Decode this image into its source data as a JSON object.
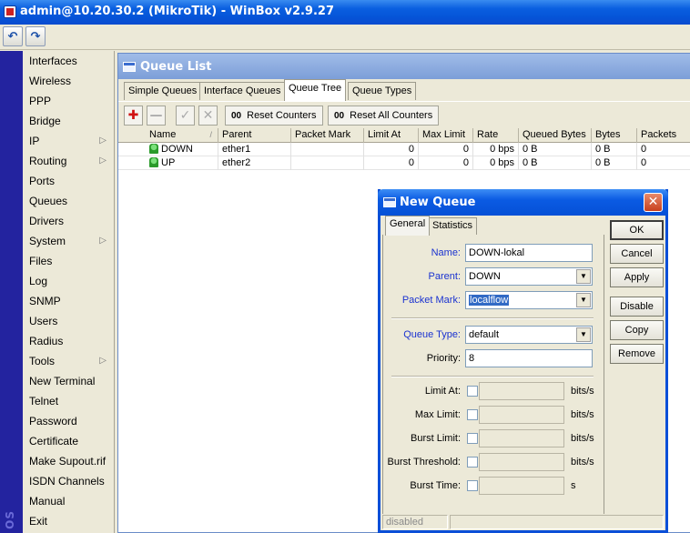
{
  "window": {
    "title": "admin@10.20.30.2 (MikroTik) - WinBox v2.9.27"
  },
  "toolbar": {
    "undo_icon": "undo-icon",
    "redo_icon": "redo-icon"
  },
  "sidebar": {
    "brand": "OS",
    "items": [
      {
        "label": "Interfaces",
        "submenu": false
      },
      {
        "label": "Wireless",
        "submenu": false
      },
      {
        "label": "PPP",
        "submenu": false
      },
      {
        "label": "Bridge",
        "submenu": false
      },
      {
        "label": "IP",
        "submenu": true
      },
      {
        "label": "Routing",
        "submenu": true
      },
      {
        "label": "Ports",
        "submenu": false
      },
      {
        "label": "Queues",
        "submenu": false
      },
      {
        "label": "Drivers",
        "submenu": false
      },
      {
        "label": "System",
        "submenu": true
      },
      {
        "label": "Files",
        "submenu": false
      },
      {
        "label": "Log",
        "submenu": false
      },
      {
        "label": "SNMP",
        "submenu": false
      },
      {
        "label": "Users",
        "submenu": false
      },
      {
        "label": "Radius",
        "submenu": false
      },
      {
        "label": "Tools",
        "submenu": true
      },
      {
        "label": "New Terminal",
        "submenu": false
      },
      {
        "label": "Telnet",
        "submenu": false
      },
      {
        "label": "Password",
        "submenu": false
      },
      {
        "label": "Certificate",
        "submenu": false
      },
      {
        "label": "Make Supout.rif",
        "submenu": false
      },
      {
        "label": "ISDN Channels",
        "submenu": false
      },
      {
        "label": "Manual",
        "submenu": false
      },
      {
        "label": "Exit",
        "submenu": false
      }
    ]
  },
  "queue_list": {
    "title": "Queue List",
    "tabs": [
      "Simple Queues",
      "Interface Queues",
      "Queue Tree",
      "Queue Types"
    ],
    "active_tab": "Queue Tree",
    "reset_counters": "Reset Counters",
    "reset_all_counters": "Reset All Counters",
    "button_prefix": "00",
    "columns": [
      "Name",
      "Parent",
      "Packet Mark",
      "Limit At",
      "Max Limit",
      "Rate",
      "Queued Bytes",
      "Bytes",
      "Packets"
    ],
    "rows": [
      {
        "name": "DOWN",
        "parent": "ether1",
        "packet_mark": "",
        "limit_at": "0",
        "max_limit": "0",
        "rate": "0 bps",
        "queued_bytes": "0 B",
        "bytes": "0 B",
        "packets": "0"
      },
      {
        "name": "UP",
        "parent": "ether2",
        "packet_mark": "",
        "limit_at": "0",
        "max_limit": "0",
        "rate": "0 bps",
        "queued_bytes": "0 B",
        "bytes": "0 B",
        "packets": "0"
      }
    ]
  },
  "dialog": {
    "title": "New Queue",
    "tabs": [
      "General",
      "Statistics"
    ],
    "fields": {
      "name": {
        "label": "Name:",
        "value": "DOWN-lokal"
      },
      "parent": {
        "label": "Parent:",
        "value": "DOWN"
      },
      "packet_mark": {
        "label": "Packet Mark:",
        "value": "localflow"
      },
      "queue_type": {
        "label": "Queue Type:",
        "value": "default"
      },
      "priority": {
        "label": "Priority:",
        "value": "8"
      },
      "limit_at": {
        "label": "Limit At:",
        "unit": "bits/s"
      },
      "max_limit": {
        "label": "Max Limit:",
        "unit": "bits/s"
      },
      "burst_limit": {
        "label": "Burst Limit:",
        "unit": "bits/s"
      },
      "burst_threshold": {
        "label": "Burst Threshold:",
        "unit": "bits/s"
      },
      "burst_time": {
        "label": "Burst Time:",
        "unit": "s"
      }
    },
    "buttons": [
      "OK",
      "Cancel",
      "Apply",
      "Disable",
      "Copy",
      "Remove"
    ],
    "status": "disabled"
  }
}
